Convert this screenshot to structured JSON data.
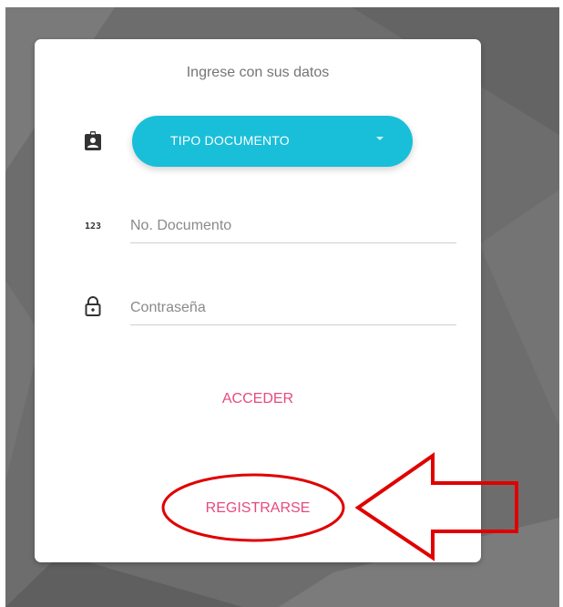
{
  "login_card": {
    "title": "Ingrese con sus datos",
    "document_type": {
      "label": "TIPO DOCUMENTO",
      "icon": "id-badge-icon"
    },
    "document_number": {
      "placeholder": "No. Documento",
      "icon": "numbers-123-icon",
      "icon_text": "123"
    },
    "password": {
      "placeholder": "Contraseña",
      "icon": "lock-icon"
    },
    "submit_label": "ACCEDER",
    "register_label": "REGISTRARSE"
  },
  "colors": {
    "background": "#6d6d6d",
    "accent": "#19bfd8",
    "button_text": "#e64a7d",
    "annotation": "#e00000"
  }
}
